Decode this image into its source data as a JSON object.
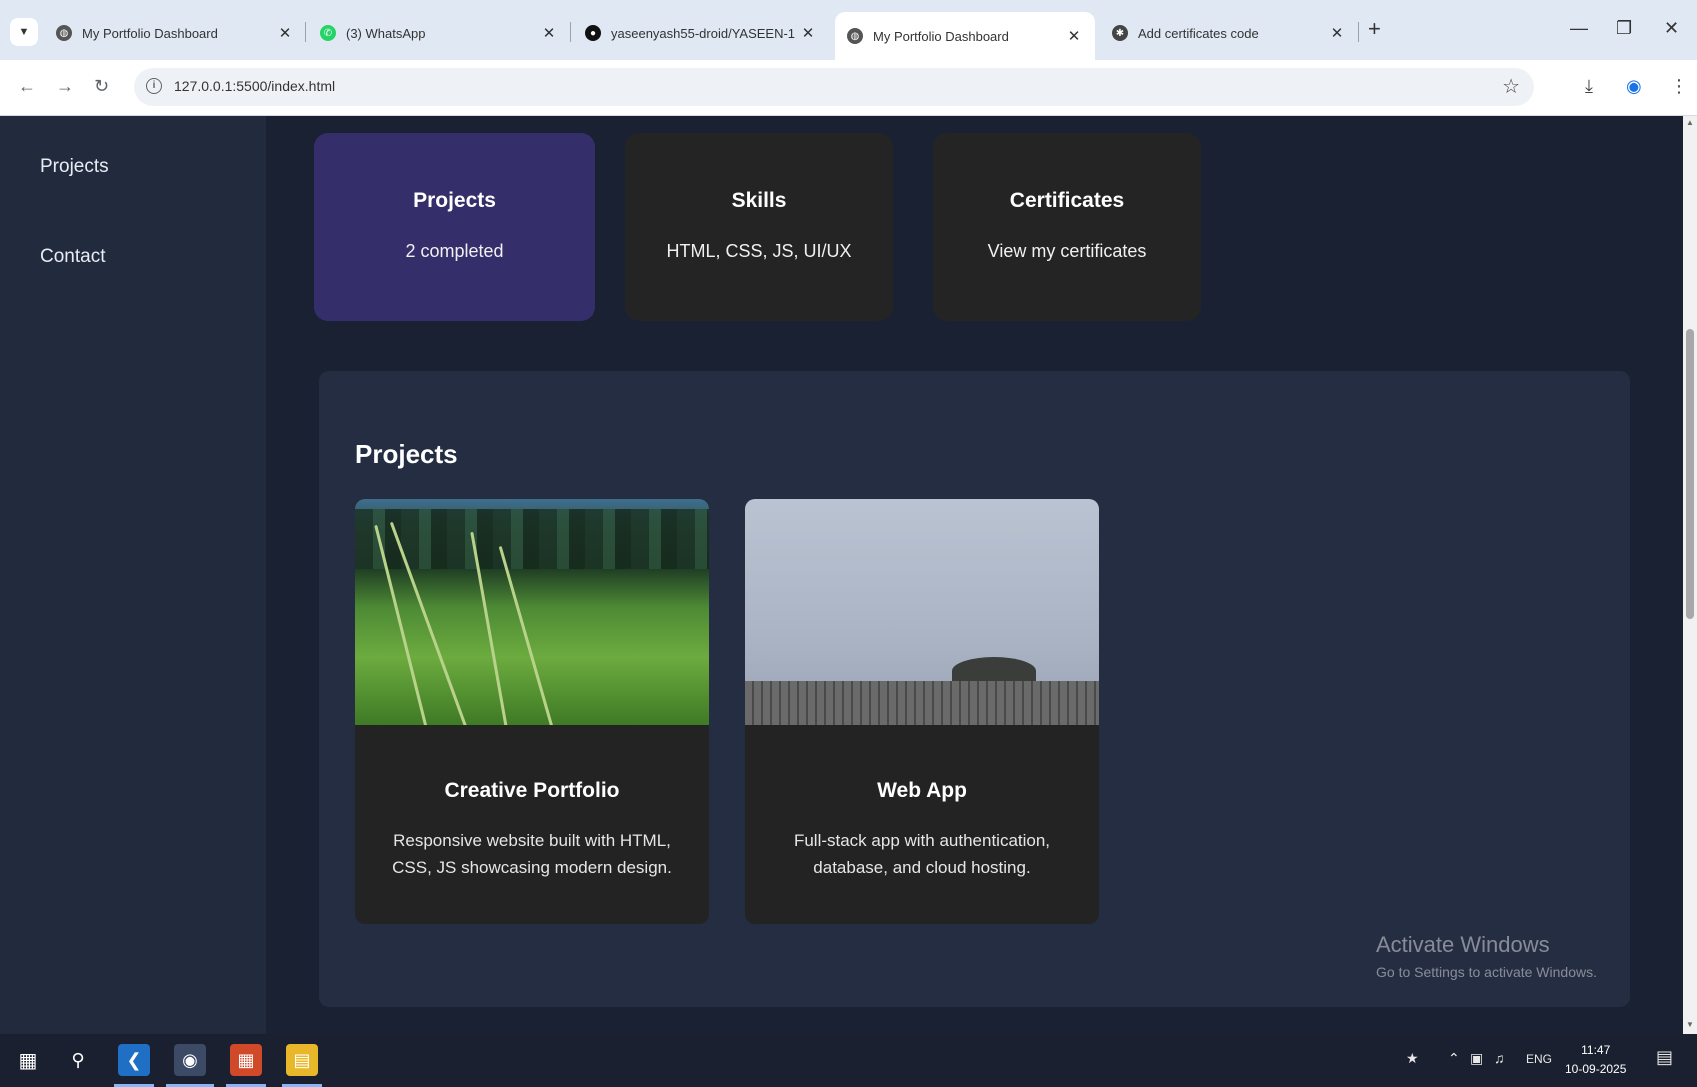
{
  "browser": {
    "tabs": [
      {
        "title": "My Portfolio Dashboard",
        "favicon": "globe-icon",
        "active": false
      },
      {
        "title": "(3) WhatsApp",
        "favicon": "whatsapp-icon",
        "active": false
      },
      {
        "title": "yaseenyash55-droid/YASEEN-1",
        "favicon": "github-icon",
        "active": false
      },
      {
        "title": "My Portfolio Dashboard",
        "favicon": "globe-icon",
        "active": true
      },
      {
        "title": "Add certificates code",
        "favicon": "openai-icon",
        "active": false
      }
    ],
    "close_glyph": "✕",
    "new_tab_glyph": "+",
    "url": "127.0.0.1:5500/index.html"
  },
  "sidebar": {
    "items": [
      {
        "label": "Projects"
      },
      {
        "label": "Contact"
      }
    ]
  },
  "stats": [
    {
      "title": "Projects",
      "subtitle": "2 completed",
      "active": true
    },
    {
      "title": "Skills",
      "subtitle": "HTML, CSS, JS, UI/UX",
      "active": false
    },
    {
      "title": "Certificates",
      "subtitle": "View my certificates",
      "active": false
    }
  ],
  "projects": {
    "heading": "Projects",
    "cards": [
      {
        "title": "Creative Portfolio",
        "description": "Responsive website built with HTML, CSS, JS showcasing modern design.",
        "image": "grass-field-photo"
      },
      {
        "title": "Web App",
        "description": "Full-stack app with authentication, database, and cloud hosting.",
        "image": "dock-and-rock-photo"
      }
    ]
  },
  "watermark": {
    "line1": "Activate Windows",
    "line2": "Go to Settings to activate Windows."
  },
  "taskbar": {
    "language": "ENG",
    "time": "11:47",
    "date": "10-09-2025"
  },
  "colors": {
    "sidebar_bg": "#222b3e",
    "page_bg": "#1a2132",
    "active_card": "#342f6b",
    "card_bg": "#242424",
    "panel_bg": "#242d42"
  }
}
